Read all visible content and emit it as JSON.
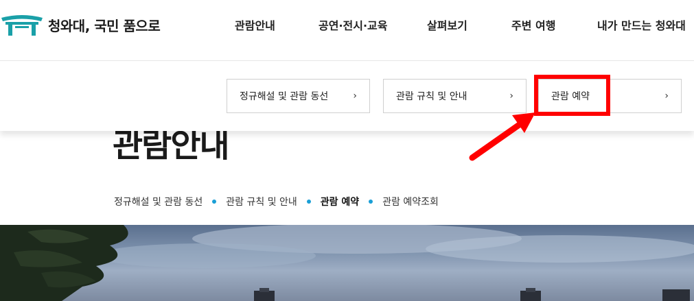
{
  "header": {
    "logo_text": "청와대, 국민 품으로",
    "nav": [
      "관람안내",
      "공연·전시·교육",
      "살펴보기",
      "주변 여행",
      "내가 만드는 청와대"
    ]
  },
  "submenu": [
    {
      "label": "정규해설 및 관람 동선",
      "chevron": "›"
    },
    {
      "label": "관람 규칙 및 안내",
      "chevron": "›"
    },
    {
      "label": "관람 예약",
      "chevron": "›"
    }
  ],
  "page": {
    "title": "관람안내"
  },
  "tabs": [
    {
      "label": "정규해설 및 관람 동선",
      "active": false
    },
    {
      "label": "관람 규칙 및 안내",
      "active": false
    },
    {
      "label": "관람 예약",
      "active": true
    },
    {
      "label": "관람 예약조회",
      "active": false
    }
  ],
  "colors": {
    "highlight": "#ff0000",
    "dot": "#1a9fd6",
    "logo": "#1aa0a8"
  }
}
